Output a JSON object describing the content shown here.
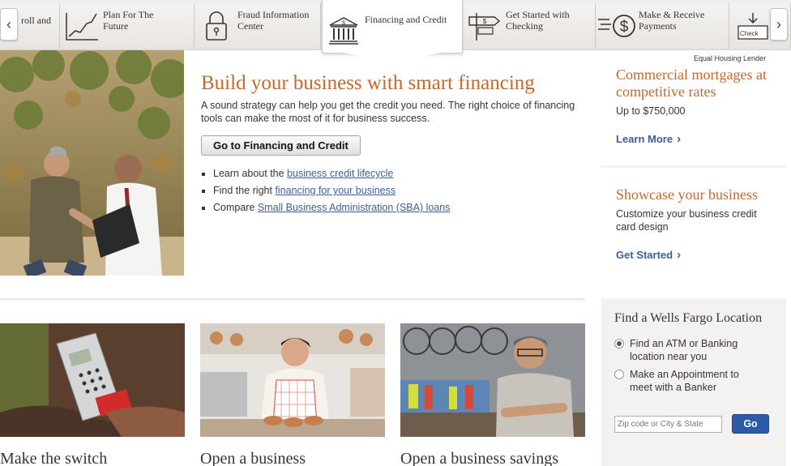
{
  "tabs": [
    {
      "label": "roll and",
      "icon": "payroll-icon",
      "active": false
    },
    {
      "label": "Plan For The Future",
      "icon": "growth-chart-icon",
      "active": false
    },
    {
      "label": "Fraud Information Center",
      "icon": "padlock-icon",
      "active": false
    },
    {
      "label": "Financing and Credit",
      "icon": "bank-building-icon",
      "active": true
    },
    {
      "label": "Get Started with Checking",
      "icon": "signpost-icon",
      "active": false
    },
    {
      "label": "Make & Receive Payments",
      "icon": "dollar-coin-icon",
      "active": false
    },
    {
      "label": "Check",
      "icon": "check-deposit-icon",
      "active": false
    }
  ],
  "hero": {
    "title": "Build your business with smart financing",
    "description": "A sound strategy can help you get the credit you need. The right choice of financing tools can make the most of it for business success.",
    "button": "Go to Financing and Credit",
    "bullets": [
      {
        "prefix": "Learn about the ",
        "link": "business credit lifecycle"
      },
      {
        "prefix": "Find the right ",
        "link": "financing for your business"
      },
      {
        "prefix": "Compare ",
        "link": "Small Business Administration (SBA) loans"
      }
    ]
  },
  "sidebar": {
    "equal_housing": "Equal Housing Lender",
    "promos": [
      {
        "title": "Commercial mortgages at competitive rates",
        "text": "Up to $750,000",
        "cta": "Learn More"
      },
      {
        "title": "Showcase your business",
        "text": "Customize your business credit card design",
        "cta": "Get Started"
      }
    ],
    "cta_chevron": "›"
  },
  "locator": {
    "title": "Find a Wells Fargo Location",
    "options": [
      "Find an ATM or Banking location near you",
      "Make an Appointment to meet with a Banker"
    ],
    "selected_index": 0,
    "placeholder": "Zip code or City & State",
    "go_label": "Go"
  },
  "cards": [
    {
      "title": "Make the switch"
    },
    {
      "title": "Open a business"
    },
    {
      "title": "Open a business savings"
    }
  ],
  "nav": {
    "prev": "‹",
    "next": "›"
  },
  "colors": {
    "accent": "#c2692f",
    "link": "#3e5f9a",
    "button": "#2a5aa8"
  }
}
